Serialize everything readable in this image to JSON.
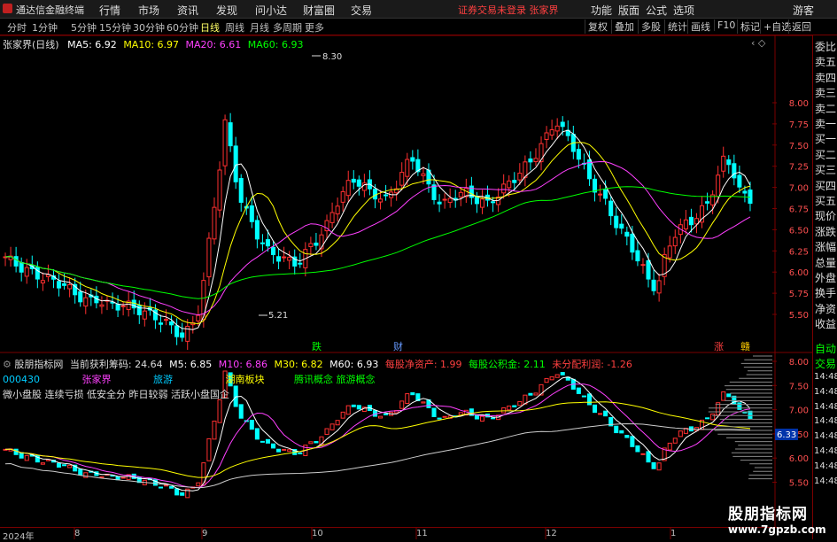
{
  "titlebar": {
    "app_name": "通达信金融终端",
    "menus": [
      "行情",
      "市场",
      "资讯",
      "发现",
      "问小达",
      "财富圈",
      "交易"
    ],
    "warning": "证券交易未登录  张家界",
    "right_menus": [
      "功能",
      "版面",
      "公式",
      "选项"
    ],
    "user": "游客"
  },
  "tabbar": {
    "tabs": [
      "分时",
      "1分钟",
      "5分钟",
      "15分钟",
      "30分钟",
      "60分钟",
      "日线",
      "周线",
      "月线",
      "多周期",
      "更多"
    ],
    "active_tab": "日线",
    "right_tabs": [
      "复权",
      "叠加",
      "多股",
      "统计",
      "画线",
      "F10",
      "标记",
      "+自选",
      "返回"
    ]
  },
  "main_chart": {
    "stock_label": "张家界(日线)",
    "ma": [
      {
        "label": "MA5: 6.92",
        "color": "#ffffff"
      },
      {
        "label": "MA10: 6.97",
        "color": "#ffff00"
      },
      {
        "label": "MA20: 6.61",
        "color": "#ff40ff"
      },
      {
        "label": "MA60: 6.93",
        "color": "#00ff00"
      }
    ],
    "high_label": "8.30",
    "low_label": "5.21",
    "markers": [
      {
        "text": "跌",
        "color": "#00ff00"
      },
      {
        "text": "财",
        "color": "#6699ff"
      },
      {
        "text": "涨",
        "color": "#ff4040"
      },
      {
        "text": "赣",
        "color": "#ffcc00"
      }
    ],
    "yaxis": [
      "8.00",
      "7.75",
      "7.50",
      "7.25",
      "7.00",
      "6.75",
      "6.50",
      "6.25",
      "6.00",
      "5.75",
      "5.50"
    ]
  },
  "sub_chart": {
    "indicator": "股朋指标网",
    "profit_label": "当前获利筹码: 24.64",
    "ma": [
      {
        "label": "M5: 6.85",
        "color": "#ffffff"
      },
      {
        "label": "M10: 6.86",
        "color": "#ff40ff"
      },
      {
        "label": "M30: 6.82",
        "color": "#ffff00"
      },
      {
        "label": "M60: 6.93",
        "color": "#ffffff"
      }
    ],
    "fin": [
      {
        "label": "每股净资产: 1.99",
        "color": "#ff4040"
      },
      {
        "label": "每股公积金: 2.11",
        "color": "#00ff00"
      },
      {
        "label": "未分配利润: -1.26",
        "color": "#ff4040"
      }
    ],
    "code": "000430",
    "name": "张家界",
    "industry": "旅游",
    "sector": "湖南板块",
    "concepts": "腾讯概念 旅游概念",
    "tags": "微小盘股 连续亏损 低安全分 昨日较弱 活跃小盘国企",
    "yaxis": [
      "8.00",
      "7.50",
      "7.00",
      "6.50",
      "6.00",
      "5.50"
    ],
    "cost_label": "6.33"
  },
  "right_panel": {
    "top_items": [
      "委比",
      "卖五",
      "卖四",
      "卖三",
      "卖二",
      "卖一",
      "买一",
      "买二",
      "买三",
      "买四",
      "买五",
      "现价",
      "涨跌",
      "涨幅",
      "总量",
      "外盘",
      "换手",
      "净资",
      "收益"
    ],
    "bottom_items": [
      "自动",
      "交易"
    ],
    "times": [
      "14:48",
      "14:48",
      "14:48",
      "14:48",
      "14:48",
      "14:48",
      "14:48",
      "14:48"
    ]
  },
  "xaxis": {
    "labels": [
      "2024年",
      "8",
      "9",
      "10",
      "11",
      "12",
      "1"
    ]
  },
  "watermark": {
    "line1": "股朋指标网",
    "line2": "www.7gpzb.com"
  }
}
